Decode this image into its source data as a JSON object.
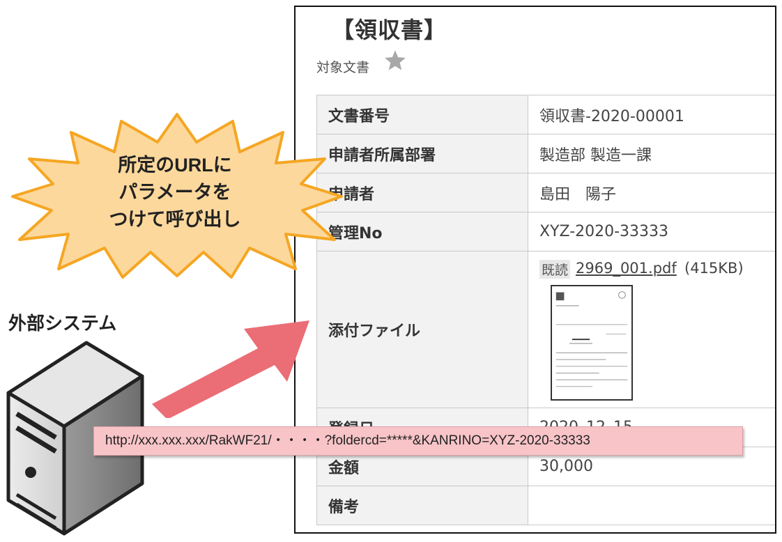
{
  "document": {
    "title": "【領収書】",
    "subtitle": "対象文書",
    "fields": [
      {
        "label": "文書番号",
        "value": "領収書-2020-00001"
      },
      {
        "label": "申請者所属部署",
        "value": "製造部 製造一課"
      },
      {
        "label": "申請者",
        "value": "島田　陽子"
      },
      {
        "label": "管理No",
        "value": "XYZ-2020-33333"
      },
      {
        "label": "添付ファイル",
        "read_badge": "既読",
        "file_name": "2969_001.pdf",
        "file_size": "(415KB)"
      },
      {
        "label": "登録日",
        "value": "2020_12_15"
      },
      {
        "label": "金額",
        "value": "30,000"
      },
      {
        "label": "備考",
        "value": ""
      }
    ]
  },
  "annotation": {
    "burst_lines": [
      "所定のURLに",
      "パラメータを",
      "つけて呼び出し"
    ],
    "external_system_label": "外部システム",
    "url": "http://xxx.xxx.xxx/RakWF21/・・・・?foldercd=*****&KANRINO=XYZ-2020-33333"
  },
  "colors": {
    "burst_fill": "#fcd89c",
    "burst_stroke": "#f5a623",
    "arrow": "#eb6d76",
    "url_bar": "#f8c4c8",
    "label_bg": "#f2f2f2"
  },
  "icons": {
    "favorite": "star-icon",
    "server": "server-icon",
    "arrow": "arrow-icon"
  }
}
